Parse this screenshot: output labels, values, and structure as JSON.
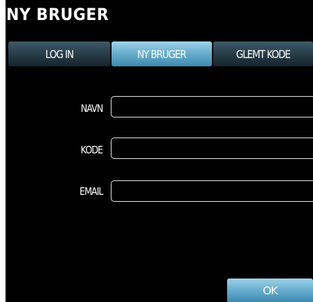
{
  "header": {
    "title": "NY BRUGER"
  },
  "tabs": [
    {
      "label": "LOG IN",
      "active": false
    },
    {
      "label": "NY BRUGER",
      "active": true
    },
    {
      "label": "GLEMT KODE",
      "active": false
    }
  ],
  "form": {
    "name_label": "NAVN",
    "name_value": "",
    "password_label": "KODE",
    "password_value": "",
    "email_label": "EMAIL",
    "email_value": ""
  },
  "actions": {
    "ok_label": "OK"
  },
  "colors": {
    "background": "#000000",
    "tab_dark": "#2a404c",
    "tab_active": "#6ab0d0",
    "field_border": "#e8e8e8",
    "text": "#ffffff"
  }
}
